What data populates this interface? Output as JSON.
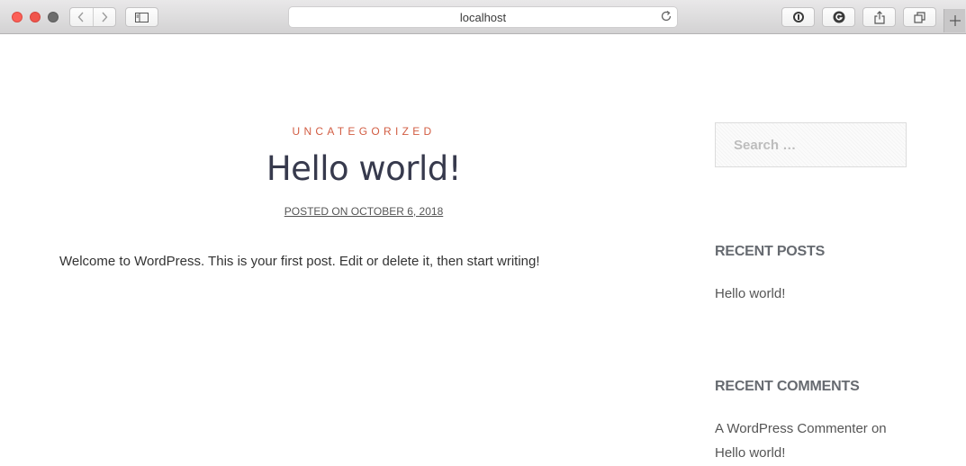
{
  "browser": {
    "address": "localhost",
    "icons": {
      "back": "chevron-left-icon",
      "forward": "chevron-right-icon",
      "sidebar": "sidebar-icon",
      "reload": "reload-icon",
      "ext1": "password-manager-icon",
      "ext2": "grammarly-icon",
      "share": "share-icon",
      "tabs": "tabs-overview-icon",
      "newtab": "plus-icon"
    }
  },
  "post": {
    "category": "UNCATEGORIZED",
    "title": "Hello world!",
    "meta": "POSTED ON OCTOBER 6, 2018",
    "body": "Welcome to WordPress. This is your first post. Edit or delete it, then start writing!"
  },
  "sidebar": {
    "search_placeholder": "Search …",
    "recent_posts_title": "RECENT POSTS",
    "recent_posts": [
      "Hello world!"
    ],
    "recent_comments_title": "RECENT COMMENTS",
    "recent_comment": {
      "author": "A WordPress Commenter",
      "on": "on",
      "post": "Hello world!"
    }
  },
  "colors": {
    "accent": "#d25d43",
    "title": "#373a4d"
  }
}
